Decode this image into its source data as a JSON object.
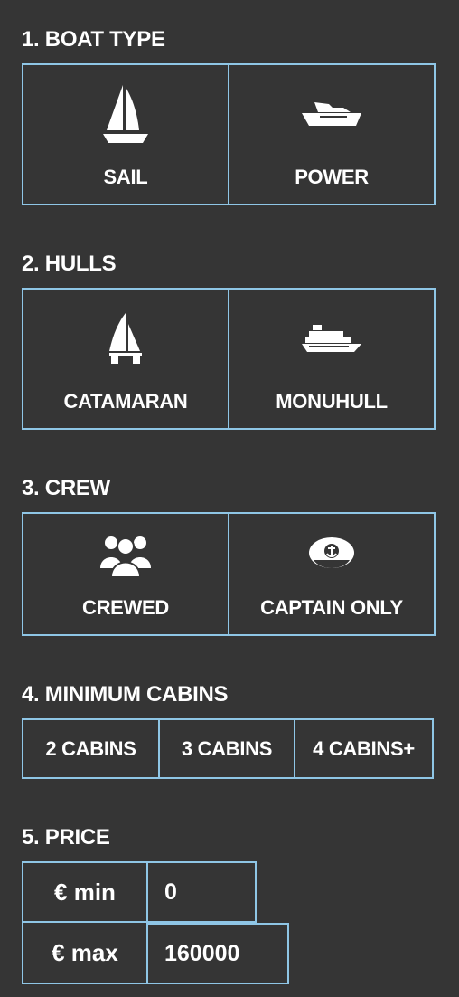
{
  "sections": {
    "boat_type": {
      "title": "1. BOAT TYPE",
      "options": [
        {
          "label": "SAIL",
          "icon": "sailboat-icon"
        },
        {
          "label": "POWER",
          "icon": "motor-yacht-icon"
        }
      ]
    },
    "hulls": {
      "title": "2. HULLS",
      "options": [
        {
          "label": "CATAMARAN",
          "icon": "catamaran-icon"
        },
        {
          "label": "MONUHULL",
          "icon": "cruise-ship-icon"
        }
      ]
    },
    "crew": {
      "title": "3. CREW",
      "options": [
        {
          "label": "CREWED",
          "icon": "group-icon"
        },
        {
          "label": "CAPTAIN ONLY",
          "icon": "captain-hat-icon"
        }
      ]
    },
    "cabins": {
      "title": "4. MINIMUM CABINS",
      "options": [
        "2 CABINS",
        "3 CABINS",
        "4 CABINS+"
      ]
    },
    "price": {
      "title": "5. PRICE",
      "min_label": "€ min",
      "min_value": "0",
      "max_label": "€ max",
      "max_value": "160000"
    }
  },
  "colors": {
    "background": "#353535",
    "border": "#8fc6e6",
    "text": "#ffffff"
  }
}
